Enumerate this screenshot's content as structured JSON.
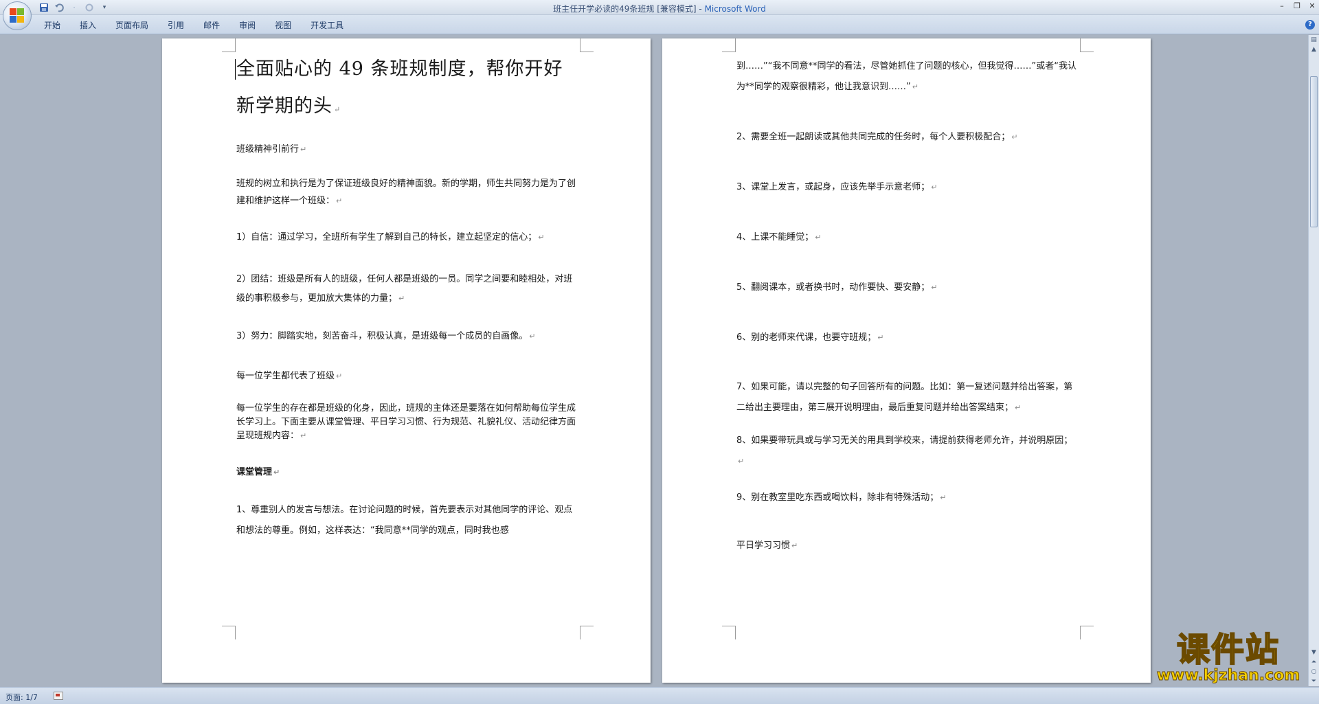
{
  "window": {
    "title_doc": "班主任开学必读的49条班规 [兼容模式] - ",
    "title_app": "Microsoft Word"
  },
  "ribbon": {
    "tabs": [
      "开始",
      "插入",
      "页面布局",
      "引用",
      "邮件",
      "审阅",
      "视图",
      "开发工具"
    ]
  },
  "page1": {
    "heading": "全面贴心的 49 条班规制度，帮你开好新学期的头",
    "paragraphs": [
      "班级精神引前行",
      "班规的树立和执行是为了保证班级良好的精神面貌。新的学期，师生共同努力是为了创建和维护这样一个班级：",
      "1）自信：通过学习，全班所有学生了解到自己的特长，建立起坚定的信心；",
      "2）团结：班级是所有人的班级，任何人都是班级的一员。同学之间要和睦相处，对班级的事积极参与，更加放大集体的力量；",
      "3）努力：脚踏实地，刻苦奋斗，积极认真，是班级每一个成员的自画像。",
      "每一位学生都代表了班级",
      "每一位学生的存在都是班级的化身，因此，班规的主体还是要落在如何帮助每位学生成长学习上。下面主要从课堂管理、平日学习习惯、行为规范、礼貌礼仪、活动纪律方面呈现班规内容：",
      "课堂管理",
      "1、尊重别人的发言与想法。在讨论问题的时候，首先要表示对其他同学的评论、观点和想法的尊重。例如，这样表达：“我同意**同学的观点，同时我也感"
    ]
  },
  "page2": {
    "paragraphs": [
      "到……”“我不同意**同学的看法，尽管她抓住了问题的核心，但我觉得……”或者“我认为**同学的观察很精彩，他让我意识到……”",
      "2、需要全班一起朗读或其他共同完成的任务时，每个人要积极配合；",
      "3、课堂上发言，或起身，应该先举手示意老师；",
      "4、上课不能睡觉；",
      "5、翻阅课本，或者换书时，动作要快、要安静；",
      "6、别的老师来代课，也要守班规；",
      "7、如果可能，请以完整的句子回答所有的问题。比如：第一复述问题并给出答案，第二给出主要理由，第三展开说明理由，最后重复问题并给出答案结束；",
      "8、如果要带玩具或与学习无关的用具到学校来，请提前获得老师允许，并说明原因；",
      "9、别在教室里吃东西或喝饮料，除非有特殊活动；",
      "平日学习习惯"
    ]
  },
  "status": {
    "page": "页面: 1/7"
  },
  "watermark": {
    "main": "课件站",
    "sub": "www.kjzhan.com"
  },
  "icons": {
    "save": "save-icon",
    "undo": "undo-icon",
    "redo": "redo-icon",
    "customize": "chevron-down-icon",
    "help": "help-icon"
  }
}
